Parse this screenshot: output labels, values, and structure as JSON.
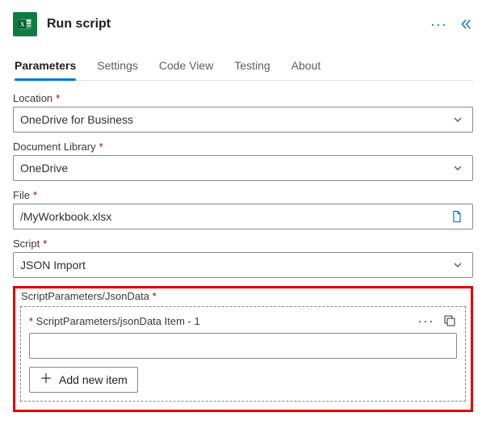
{
  "header": {
    "title": "Run script"
  },
  "tabs": {
    "items": [
      {
        "label": "Parameters",
        "active": true
      },
      {
        "label": "Settings"
      },
      {
        "label": "Code View"
      },
      {
        "label": "Testing"
      },
      {
        "label": "About"
      }
    ]
  },
  "fields": {
    "location": {
      "label": "Location",
      "required": true,
      "value": "OneDrive for Business"
    },
    "documentLibrary": {
      "label": "Document Library",
      "required": true,
      "value": "OneDrive"
    },
    "file": {
      "label": "File",
      "required": true,
      "value": "/MyWorkbook.xlsx"
    },
    "script": {
      "label": "Script",
      "required": true,
      "value": "JSON Import"
    }
  },
  "jsonData": {
    "label": "ScriptParameters/JsonData",
    "required": true,
    "item": {
      "title": "ScriptParameters/jsonData Item - 1",
      "required": true,
      "value": ""
    },
    "addButton": "Add new item"
  }
}
